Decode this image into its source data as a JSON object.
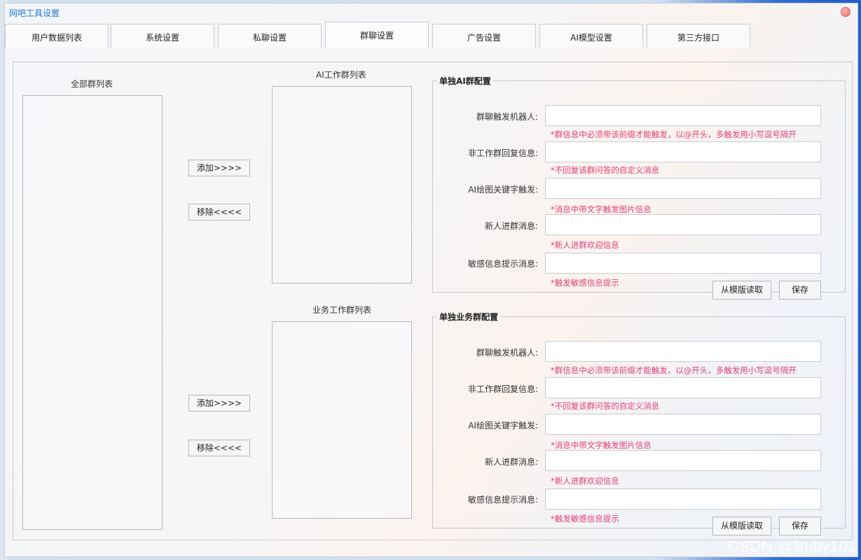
{
  "window": {
    "title": "网吧工具设置"
  },
  "tabs": [
    {
      "label": "用户数据列表"
    },
    {
      "label": "系统设置"
    },
    {
      "label": "私聊设置"
    },
    {
      "label": "群聊设置",
      "active": true
    },
    {
      "label": "广告设置"
    },
    {
      "label": "AI模型设置"
    },
    {
      "label": "第三方接口"
    }
  ],
  "lists": {
    "all_groups_label": "全部群列表",
    "ai_groups_label": "AI工作群列表",
    "business_groups_label": "业务工作群列表"
  },
  "transfer_buttons": {
    "add": "添加>>>>",
    "remove": "移除<<<<"
  },
  "ai_group_config": {
    "title": "单独AI群配置",
    "fields": [
      {
        "label": "群聊触发机器人:",
        "value": "",
        "hint": "*群信息中必须带该前缀才能触发，以@开头，多触发用小写逗号隔开"
      },
      {
        "label": "非工作群回复信息:",
        "value": "",
        "hint": "*不回复该群问答的自定义消息"
      },
      {
        "label": "AI绘图关键字触发:",
        "value": "",
        "hint": "*消息中带文字触发图片信息"
      },
      {
        "label": "新人进群消息:",
        "value": "",
        "hint": "*新人进群欢迎信息"
      },
      {
        "label": "敏感信息提示消息:",
        "value": "",
        "hint": "*触发敏感信息提示"
      }
    ],
    "load_button": "从模版读取",
    "save_button": "保存"
  },
  "business_group_config": {
    "title": "单独业务群配置",
    "fields": [
      {
        "label": "群聊触发机器人:",
        "value": "",
        "hint": "*群信息中必须带该前缀才能触发，以@开头，多触发用小写逗号隔开"
      },
      {
        "label": "非工作群回复信息:",
        "value": "",
        "hint": "*不回复该群问答的自定义消息"
      },
      {
        "label": "AI绘图关键字触发:",
        "value": "",
        "hint": "*消息中带文字触发图片信息"
      },
      {
        "label": "新人进群消息:",
        "value": "",
        "hint": "*新人进群欢迎信息"
      },
      {
        "label": "敏感信息提示消息:",
        "value": "",
        "hint": "*触发敏感信息提示"
      }
    ],
    "load_button": "从模版读取",
    "save_button": "保存"
  },
  "watermark": "CSDN @Buby101",
  "colors": {
    "title": "#1e7bd6",
    "hint": "#e0407a",
    "close": "#f07070"
  }
}
